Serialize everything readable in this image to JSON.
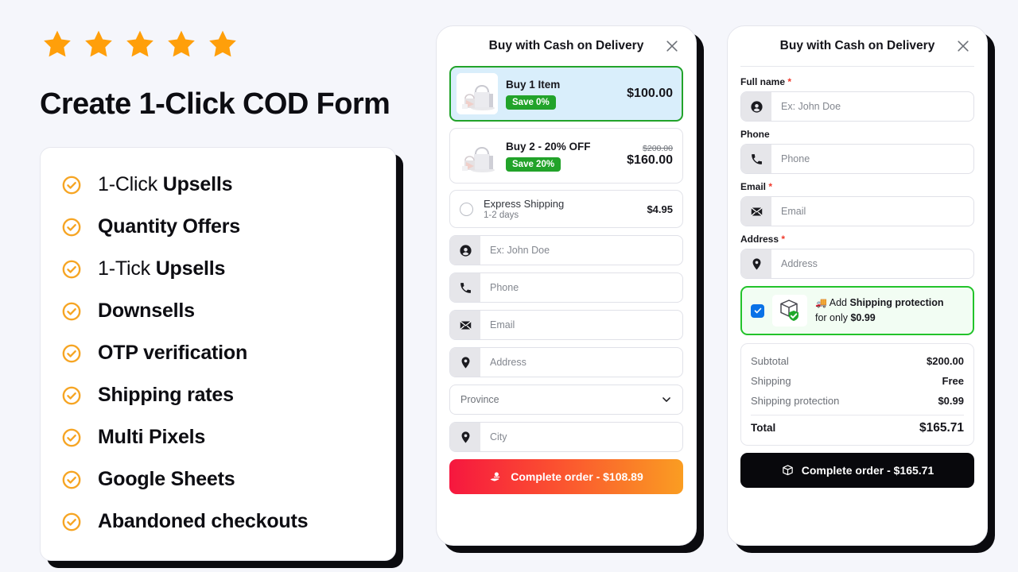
{
  "colors": {
    "background": "#f5f6fb",
    "star": "#FF9F0A",
    "check": "#F6A524",
    "save_badge": "#22a32a",
    "selected_offer_bg": "#d9eefb",
    "selected_offer_border": "#22a32a",
    "cta_gradient_from": "#f6173f",
    "cta_gradient_to": "#fa9d22",
    "cta_black": "#08080c",
    "checkbox_blue": "#0b72e7",
    "protection_border": "#23c32b",
    "protection_bg": "#f2fdf3",
    "required_asterisk": "#f0392b",
    "panel_shadow": "#0b0b0f"
  },
  "left": {
    "star_count": 5,
    "star_icon": "star-icon",
    "headline": "Create 1-Click COD Form",
    "features": [
      {
        "lead": "1-Click ",
        "strong": "Upsells",
        "icon": "check-circle-icon"
      },
      {
        "lead": "",
        "strong": "Quantity Offers",
        "icon": "check-circle-icon"
      },
      {
        "lead": "1-Tick ",
        "strong": "Upsells",
        "icon": "check-circle-icon"
      },
      {
        "lead": "",
        "strong": "Downsells",
        "icon": "check-circle-icon"
      },
      {
        "lead": "",
        "strong": "OTP verification",
        "icon": "check-circle-icon"
      },
      {
        "lead": "",
        "strong": "Shipping rates",
        "icon": "check-circle-icon"
      },
      {
        "lead": "",
        "strong": "Multi Pixels",
        "icon": "check-circle-icon"
      },
      {
        "lead": "",
        "strong": "Google Sheets",
        "icon": "check-circle-icon"
      },
      {
        "lead": "",
        "strong": "Abandoned checkouts",
        "icon": "check-circle-icon"
      }
    ]
  },
  "middle_panel": {
    "title": "Buy with Cash on Delivery",
    "close_icon": "close-icon",
    "offers": [
      {
        "name": "Buy 1 Item",
        "badge": "Save 0%",
        "price": "$100.00",
        "compare_at": "",
        "selected": true,
        "thumb_icon": "handbag-product-icon"
      },
      {
        "name": "Buy 2 - 20% OFF",
        "badge": "Save 20%",
        "price": "$160.00",
        "compare_at": "$200.00",
        "selected": false,
        "thumb_icon": "handbag-product-icon"
      }
    ],
    "shipping_option": {
      "name": "Express Shipping",
      "sub": "1-2 days",
      "price": "$4.95",
      "selected": false
    },
    "fields": [
      {
        "icon": "user-icon",
        "placeholder": "Ex: John Doe",
        "value": "",
        "name": "full-name"
      },
      {
        "icon": "phone-icon",
        "placeholder": "Phone",
        "value": "",
        "name": "phone"
      },
      {
        "icon": "email-icon",
        "placeholder": "Email",
        "value": "",
        "name": "email"
      },
      {
        "icon": "location-pin-icon",
        "placeholder": "Address",
        "value": "",
        "name": "address"
      }
    ],
    "province_select": {
      "label": "Province",
      "icon": "chevron-down-icon"
    },
    "city_field": {
      "icon": "location-pin-icon",
      "placeholder": "City",
      "value": ""
    },
    "cta": {
      "label": "Complete order - $108.89",
      "icon": "hand-money-icon"
    }
  },
  "right_panel": {
    "title": "Buy with Cash on Delivery",
    "close_icon": "close-icon",
    "fields": [
      {
        "label": "Full name",
        "required": true,
        "icon": "user-icon",
        "placeholder": "Ex: John Doe",
        "value": ""
      },
      {
        "label": "Phone",
        "required": false,
        "icon": "phone-icon",
        "placeholder": "Phone",
        "value": ""
      },
      {
        "label": "Email",
        "required": true,
        "icon": "email-icon",
        "placeholder": "Email",
        "value": ""
      },
      {
        "label": "Address",
        "required": true,
        "icon": "location-pin-icon",
        "placeholder": "Address",
        "value": ""
      }
    ],
    "protection": {
      "checked": true,
      "truck_emoji": "🚚",
      "text_prefix": "Add ",
      "text_strong": "Shipping protection",
      "text_line2_prefix": "for only ",
      "text_line2_strong": "$0.99",
      "icon": "package-shield-icon"
    },
    "totals": [
      {
        "key": "Subtotal",
        "value": "$200.00"
      },
      {
        "key": "Shipping",
        "value": "Free"
      },
      {
        "key": "Shipping protection",
        "value": "$0.99"
      }
    ],
    "total": {
      "key": "Total",
      "value": "$165.71"
    },
    "cta": {
      "label": "Complete order - $165.71",
      "icon": "box-3d-icon"
    }
  }
}
